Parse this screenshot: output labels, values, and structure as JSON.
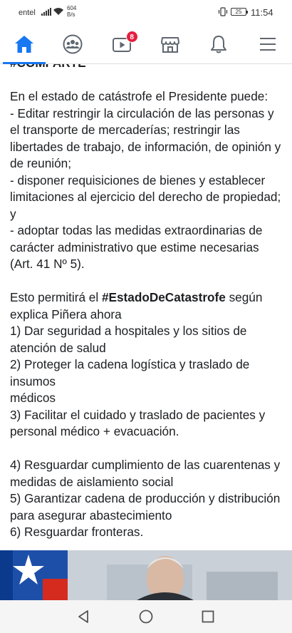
{
  "status_bar": {
    "carrier": "entel",
    "speed_value": "604",
    "speed_unit": "B/s",
    "battery": "25",
    "time": "11:54"
  },
  "nav": {
    "items": [
      {
        "name": "home",
        "icon": "home-icon",
        "active": true
      },
      {
        "name": "groups",
        "icon": "groups-icon",
        "active": false
      },
      {
        "name": "watch",
        "icon": "video-icon",
        "active": false,
        "badge": "8"
      },
      {
        "name": "marketplace",
        "icon": "store-icon",
        "active": false
      },
      {
        "name": "notifications",
        "icon": "bell-icon",
        "active": false
      },
      {
        "name": "menu",
        "icon": "menu-icon",
        "active": false
      }
    ],
    "accent": "#1877f2",
    "badge_color": "#e41e3f"
  },
  "post": {
    "clipped_hashtag": "#COMPARTE",
    "intro": "En el estado de catástrofe el Presidente puede:",
    "powers": [
      "- Editar restringir la circulación de las personas y el transporte de mercaderías; restringir las libertades de trabajo, de información, de opinión y de reunión;",
      "- disponer requisiciones de bienes y establecer limitaciones al ejercicio del derecho de propiedad; y",
      "- adoptar todas las medidas extraordinarias de carácter administrativo que estime necesarias (Art. 41 Nº 5)."
    ],
    "allows_prefix": "Esto permitirá el ",
    "allows_hashtag": "#EstadoDeCatastrofe",
    "allows_suffix": " según explica Piñera ahora",
    "measures_a": [
      "1) Dar seguridad a hospitales y los sitios de atención de salud",
      "2) Proteger la cadena logística y traslado de insumos\nmédicos",
      "3) Facilitar el cuidado y traslado de pacientes y personal médico + evacuación."
    ],
    "measures_b": [
      "4) Resguardar cumplimiento de las cuarentenas y medidas de aislamiento social",
      "5) Garantizar cadena de producción y distribución para asegurar abastecimiento",
      "6) Resguardar fronteras."
    ]
  },
  "android_nav": {
    "back": "back-icon",
    "home": "home-circle-icon",
    "recents": "recents-icon"
  }
}
